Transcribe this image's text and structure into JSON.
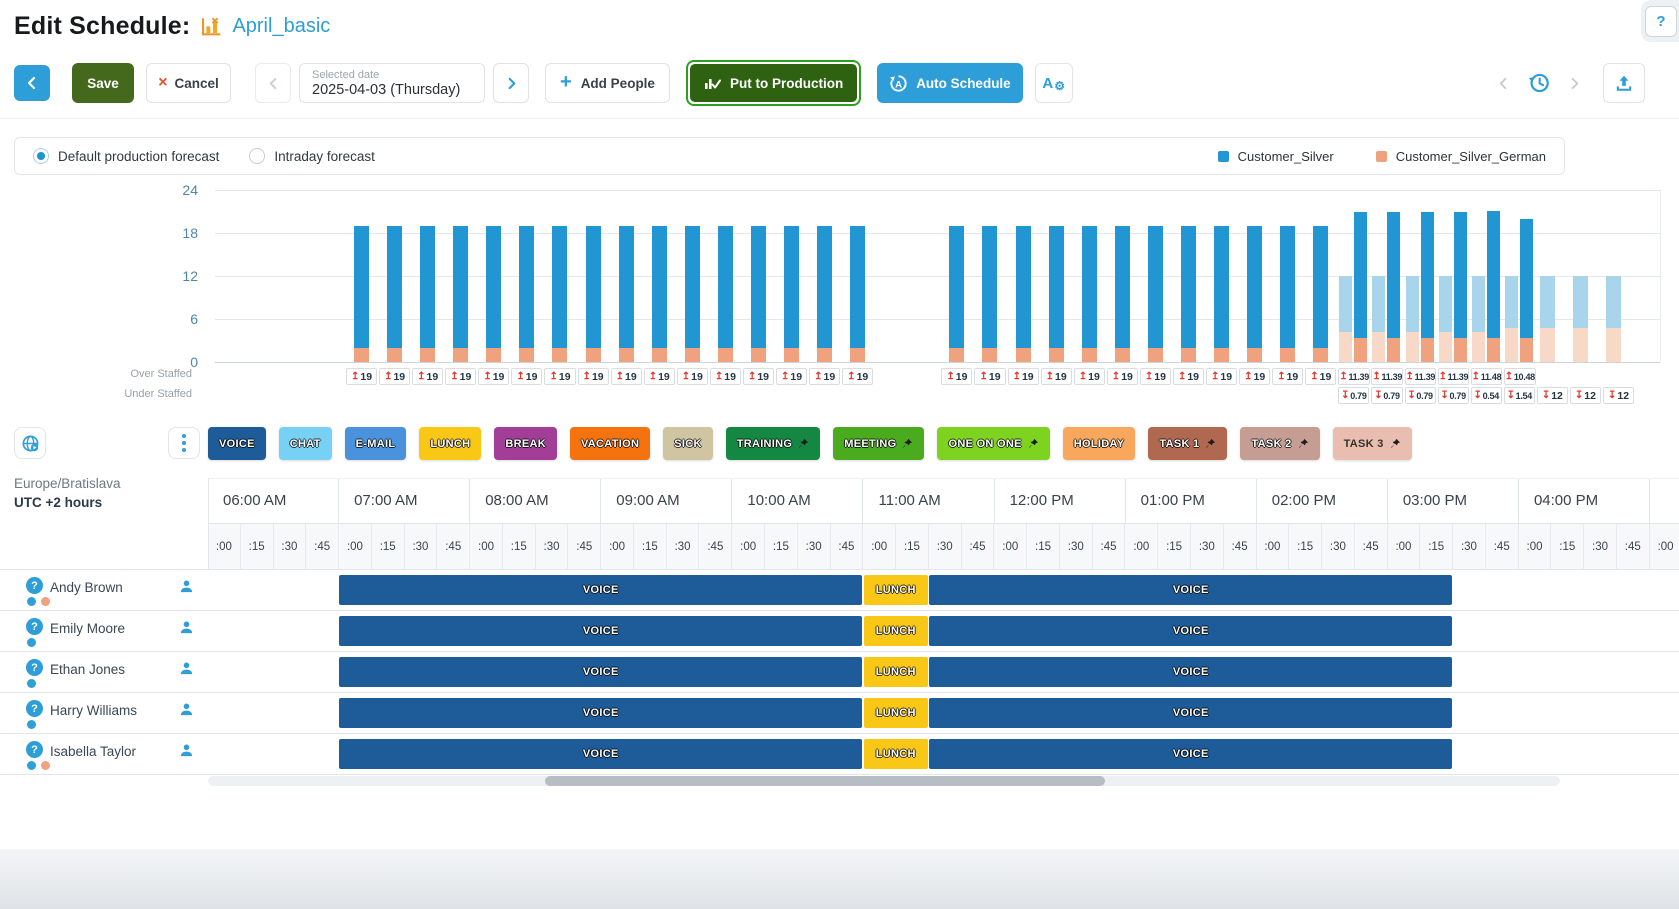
{
  "header": {
    "title": "Edit Schedule:",
    "schedule_name": "April_basic",
    "help_label": "?"
  },
  "toolbar": {
    "save": "Save",
    "cancel": "Cancel",
    "selected_date_label": "Selected date",
    "selected_date_value": "2025-04-03 (Thursday)",
    "add_people": "Add People",
    "put_to_production": "Put to Production",
    "auto_schedule": "Auto Schedule"
  },
  "forecast": {
    "options": [
      {
        "label": "Default production forecast",
        "selected": true
      },
      {
        "label": "Intraday forecast",
        "selected": false
      }
    ],
    "legend": [
      {
        "label": "Customer_Silver",
        "color": "#2196d3"
      },
      {
        "label": "Customer_Silver_German",
        "color": "#f0a17e"
      }
    ]
  },
  "chart_data": {
    "type": "bar",
    "stacked": true,
    "yticks": [
      0,
      6,
      12,
      18,
      24
    ],
    "ylim": [
      0,
      26
    ],
    "axis_captions": [
      "Over Staffed",
      "Under Staffed"
    ],
    "series": [
      {
        "name": "Customer_Silver",
        "color": "#2196d3",
        "light_color": "#a8d4ec"
      },
      {
        "name": "Customer_Silver_German",
        "color": "#f0a17e",
        "light_color": "#f8d8c7"
      }
    ],
    "slots": [
      {
        "over": "19",
        "scheduled": [
          2,
          17
        ]
      },
      {
        "over": "19",
        "scheduled": [
          2,
          17
        ]
      },
      {
        "over": "19",
        "scheduled": [
          2,
          17
        ]
      },
      {
        "over": "19",
        "scheduled": [
          2,
          17
        ]
      },
      {
        "over": "19",
        "scheduled": [
          2,
          17
        ]
      },
      {
        "over": "19",
        "scheduled": [
          2,
          17
        ]
      },
      {
        "over": "19",
        "scheduled": [
          2,
          17
        ]
      },
      {
        "over": "19",
        "scheduled": [
          2,
          17
        ]
      },
      {
        "over": "19",
        "scheduled": [
          2,
          17
        ]
      },
      {
        "over": "19",
        "scheduled": [
          2,
          17
        ]
      },
      {
        "over": "19",
        "scheduled": [
          2,
          17
        ]
      },
      {
        "over": "19",
        "scheduled": [
          2,
          17
        ]
      },
      {
        "over": "19",
        "scheduled": [
          2,
          17
        ]
      },
      {
        "over": "19",
        "scheduled": [
          2,
          17
        ]
      },
      {
        "over": "19",
        "scheduled": [
          2,
          17
        ]
      },
      {
        "over": "19",
        "scheduled": [
          2,
          17
        ]
      },
      {},
      {},
      {
        "over": "19",
        "scheduled": [
          2,
          17
        ]
      },
      {
        "over": "19",
        "scheduled": [
          2,
          17
        ]
      },
      {
        "over": "19",
        "scheduled": [
          2,
          17
        ]
      },
      {
        "over": "19",
        "scheduled": [
          2,
          17
        ]
      },
      {
        "over": "19",
        "scheduled": [
          2,
          17
        ]
      },
      {
        "over": "19",
        "scheduled": [
          2,
          17
        ]
      },
      {
        "over": "19",
        "scheduled": [
          2,
          17
        ]
      },
      {
        "over": "19",
        "scheduled": [
          2,
          17
        ]
      },
      {
        "over": "19",
        "scheduled": [
          2,
          17
        ]
      },
      {
        "over": "19",
        "scheduled": [
          2,
          17
        ]
      },
      {
        "over": "19",
        "scheduled": [
          2,
          17
        ]
      },
      {
        "over": "19",
        "scheduled": [
          2,
          17
        ]
      },
      {
        "over": "11.39",
        "under": "0.79",
        "scheduled": [
          3.4,
          17.5
        ],
        "forecast": [
          4.2,
          7.8
        ]
      },
      {
        "over": "11.39",
        "under": "0.79",
        "scheduled": [
          3.4,
          17.5
        ],
        "forecast": [
          4.2,
          7.8
        ]
      },
      {
        "over": "11.39",
        "under": "0.79",
        "scheduled": [
          3.4,
          17.5
        ],
        "forecast": [
          4.2,
          7.8
        ]
      },
      {
        "over": "11.39",
        "under": "0.79",
        "scheduled": [
          3.4,
          17.5
        ],
        "forecast": [
          4.2,
          7.8
        ]
      },
      {
        "over": "11.48",
        "under": "0.54",
        "scheduled": [
          3.4,
          17.7
        ],
        "forecast": [
          4.2,
          7.8
        ]
      },
      {
        "over": "10.48",
        "under": "1.54",
        "scheduled": [
          3.4,
          16.6
        ],
        "forecast": [
          4.8,
          7.2
        ]
      },
      {
        "under": "12",
        "forecast": [
          4.8,
          7.2
        ]
      },
      {
        "under": "12",
        "forecast": [
          4.8,
          7.2
        ]
      },
      {
        "under": "12",
        "forecast": [
          4.8,
          7.2
        ]
      }
    ]
  },
  "activities": {
    "items": [
      {
        "label": "VOICE",
        "color": "#1e5c99",
        "pinned": false
      },
      {
        "label": "CHAT",
        "color": "#76d1f5",
        "pinned": false
      },
      {
        "label": "E-MAIL",
        "color": "#4a92dc",
        "pinned": false
      },
      {
        "label": "LUNCH",
        "color": "#f9c716",
        "pinned": false
      },
      {
        "label": "BREAK",
        "color": "#a23e98",
        "pinned": false
      },
      {
        "label": "VACATION",
        "color": "#f4730f",
        "pinned": false
      },
      {
        "label": "SICK",
        "color": "#cfc5a3",
        "pinned": false
      },
      {
        "label": "TRAINING",
        "color": "#148743",
        "pinned": true
      },
      {
        "label": "MEETING",
        "color": "#4aab1e",
        "pinned": true
      },
      {
        "label": "ONE ON ONE",
        "color": "#7ed321",
        "pinned": true
      },
      {
        "label": "HOLIDAY",
        "color": "#f9a75c",
        "pinned": false
      },
      {
        "label": "TASK 1",
        "color": "#b06850",
        "pinned": true
      },
      {
        "label": "TASK 2",
        "color": "#c69d92",
        "pinned": true
      },
      {
        "label": "TASK 3",
        "color": "#e9beb0",
        "pinned": true,
        "dark_text": true
      }
    ]
  },
  "timezone": {
    "city": "Europe/Bratislava",
    "utc": "UTC +2 hours"
  },
  "timeline": {
    "hours": [
      "06:00 AM",
      "07:00 AM",
      "08:00 AM",
      "09:00 AM",
      "10:00 AM",
      "11:00 AM",
      "12:00 PM",
      "01:00 PM",
      "02:00 PM",
      "03:00 PM",
      "04:00 PM"
    ],
    "quarters": [
      ":00",
      ":15",
      ":30",
      ":45"
    ]
  },
  "schedule": {
    "employees": [
      {
        "name": "Andy Brown",
        "dots": [
          "#2e9fd9",
          "#f0a17e"
        ]
      },
      {
        "name": "Emily Moore",
        "dots": [
          "#2e9fd9"
        ]
      },
      {
        "name": "Ethan Jones",
        "dots": [
          "#2e9fd9"
        ]
      },
      {
        "name": "Harry Williams",
        "dots": [
          "#2e9fd9"
        ]
      },
      {
        "name": "Isabella Taylor",
        "dots": [
          "#2e9fd9",
          "#f0a17e"
        ]
      }
    ],
    "shift_segments": [
      {
        "label": "VOICE",
        "start_min": 60,
        "end_min": 300,
        "color": "#1e5c99"
      },
      {
        "label": "LUNCH",
        "start_min": 300,
        "end_min": 330,
        "color": "#f9c716"
      },
      {
        "label": "VOICE",
        "start_min": 330,
        "end_min": 570,
        "color": "#1e5c99"
      }
    ]
  }
}
